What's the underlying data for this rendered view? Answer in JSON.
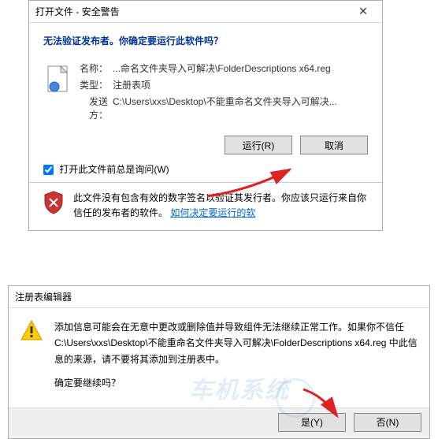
{
  "dialog1": {
    "title": "打开文件 - 安全警告",
    "question": "无法验证发布者。你确定要运行此软件吗？",
    "name_label": "名称：",
    "name_value": "...命名文件夹导入可解决\\FolderDescriptions x64.reg",
    "type_label": "类型：",
    "type_value": "注册表项",
    "from_label": "发送方：",
    "from_value": "C:\\Users\\xxs\\Desktop\\不能重命名文件夹导入可解决...",
    "run_btn": "运行(R)",
    "cancel_btn": "取消",
    "checkbox_label": "打开此文件前总是询问(W)",
    "warning_text": "此文件没有包含有效的数字签名以验证其发行者。你应该只运行来自你信任的发布者的软件。",
    "warning_link": "如何决定要运行的软"
  },
  "dialog2": {
    "title": "注册表编辑器",
    "message1": "添加信息可能会在无意中更改或删除值并导致组件无法继续正常工作。如果你不信任 C:\\Users\\xxs\\Desktop\\不能重命名文件夹导入可解决\\FolderDescriptions x64.reg 中此信息的来源，请不要将其添加到注册表中。",
    "message2": "确定要继续吗？",
    "yes_btn": "是(Y)",
    "no_btn": "否(N)"
  },
  "watermark": "车机系统"
}
